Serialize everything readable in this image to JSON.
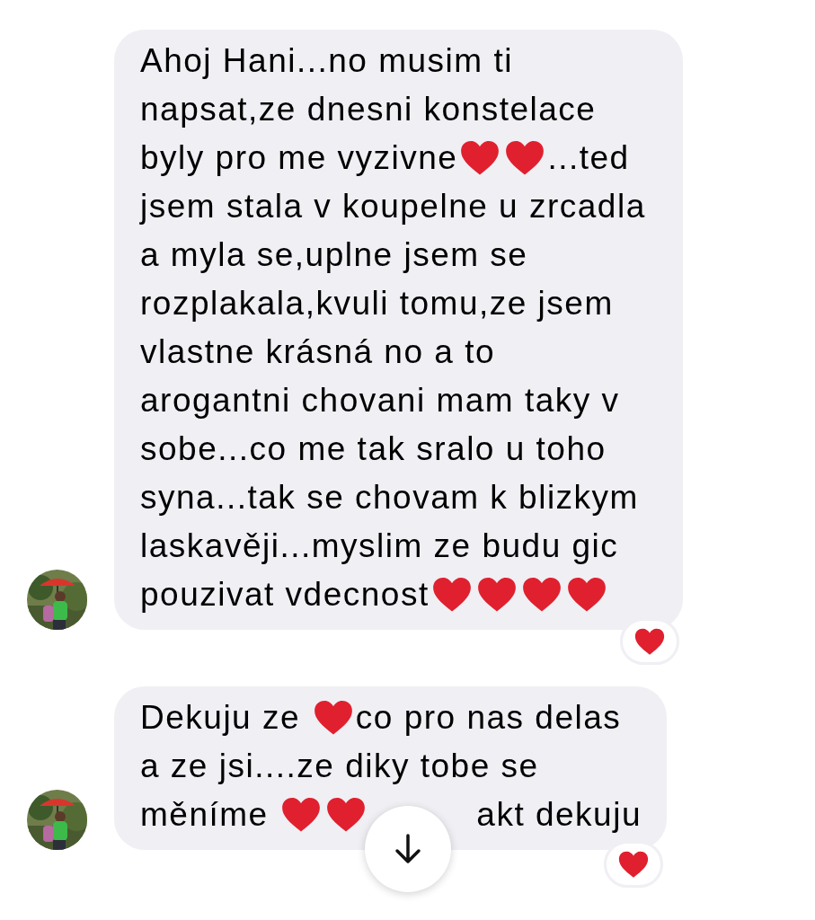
{
  "messages": [
    {
      "lines": [
        [
          {
            "kind": "text",
            "text": "Ahoj Hani...no musim ti"
          }
        ],
        [
          {
            "kind": "text",
            "text": "napsat,ze dnesni konstelace"
          }
        ],
        [
          {
            "kind": "text",
            "text": "byly pro me vyzivne"
          },
          {
            "kind": "heart"
          },
          {
            "kind": "heart"
          },
          {
            "kind": "text",
            "text": "...ted"
          }
        ],
        [
          {
            "kind": "text",
            "text": "jsem stala v koupelne u zrcadla"
          }
        ],
        [
          {
            "kind": "text",
            "text": "a myla se,uplne jsem se"
          }
        ],
        [
          {
            "kind": "text",
            "text": "rozplakala,kvuli tomu,ze jsem"
          }
        ],
        [
          {
            "kind": "text",
            "text": "vlastne krásná no a to"
          }
        ],
        [
          {
            "kind": "text",
            "text": "arogantni chovani mam taky v"
          }
        ],
        [
          {
            "kind": "text",
            "text": "sobe...co me tak sralo u toho"
          }
        ],
        [
          {
            "kind": "text",
            "text": "syna...tak se chovam k blizkym"
          }
        ],
        [
          {
            "kind": "text",
            "text": "laskavěji...myslim ze budu gic"
          }
        ],
        [
          {
            "kind": "text",
            "text": "pouzivat vdecnost"
          },
          {
            "kind": "heart"
          },
          {
            "kind": "heart"
          },
          {
            "kind": "heart"
          },
          {
            "kind": "heart"
          }
        ]
      ]
    },
    {
      "lines": [
        [
          {
            "kind": "text",
            "text": "Dekuju ze "
          },
          {
            "kind": "heart"
          },
          {
            "kind": "text",
            "text": "co pro nas delas"
          }
        ],
        [
          {
            "kind": "text",
            "text": "a ze jsi....ze diky tobe se"
          }
        ],
        [
          {
            "kind": "text",
            "text": "měníme "
          },
          {
            "kind": "heart"
          },
          {
            "kind": "heart"
          },
          {
            "kind": "text",
            "text": "akt dekuju"
          }
        ]
      ]
    }
  ]
}
